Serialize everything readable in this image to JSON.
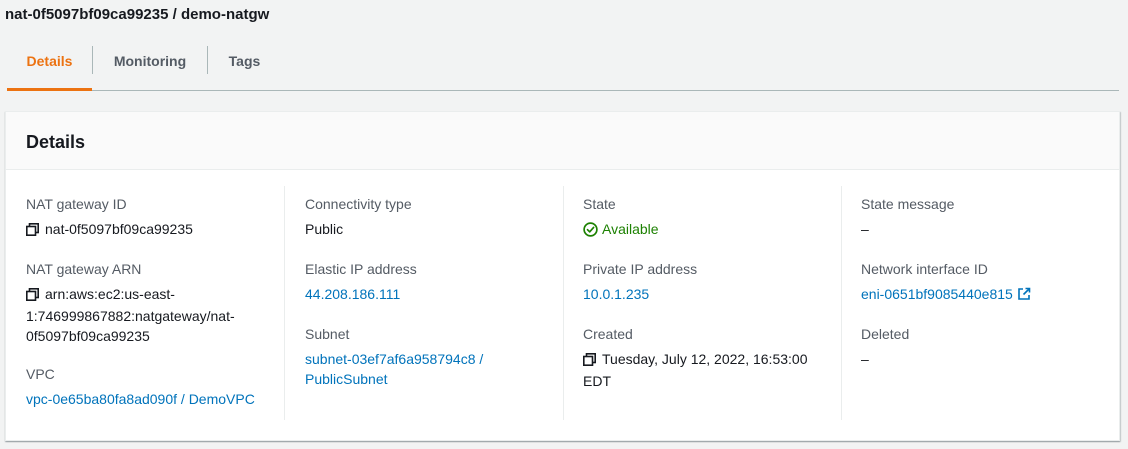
{
  "page": {
    "title": "nat-0f5097bf09ca99235 / demo-natgw"
  },
  "tabs": [
    {
      "label": "Details"
    },
    {
      "label": "Monitoring"
    },
    {
      "label": "Tags"
    }
  ],
  "details": {
    "heading": "Details",
    "nat_gateway_id": {
      "label": "NAT gateway ID",
      "value": "nat-0f5097bf09ca99235"
    },
    "nat_gateway_arn": {
      "label": "NAT gateway ARN",
      "line1": "arn:aws:ec2:us-east-",
      "line2": "1:746999867882:natgateway/nat-",
      "line3": "0f5097bf09ca99235"
    },
    "vpc": {
      "label": "VPC",
      "value": "vpc-0e65ba80fa8ad090f / DemoVPC"
    },
    "connectivity_type": {
      "label": "Connectivity type",
      "value": "Public"
    },
    "elastic_ip": {
      "label": "Elastic IP address",
      "value": "44.208.186.111"
    },
    "subnet": {
      "label": "Subnet",
      "line1": "subnet-03ef7af6a958794c8 /",
      "line2": "PublicSubnet"
    },
    "state": {
      "label": "State",
      "value": "Available"
    },
    "private_ip": {
      "label": "Private IP address",
      "value": "10.0.1.235"
    },
    "created": {
      "label": "Created",
      "line1": "Tuesday, July 12, 2022, 16:53:00",
      "line2": "EDT"
    },
    "state_message": {
      "label": "State message",
      "value": "–"
    },
    "network_interface": {
      "label": "Network interface ID",
      "value": "eni-0651bf9085440e815"
    },
    "deleted": {
      "label": "Deleted",
      "value": "–"
    }
  },
  "colors": {
    "accent": "#ec7211",
    "link": "#0073bb",
    "success": "#1d8102"
  }
}
